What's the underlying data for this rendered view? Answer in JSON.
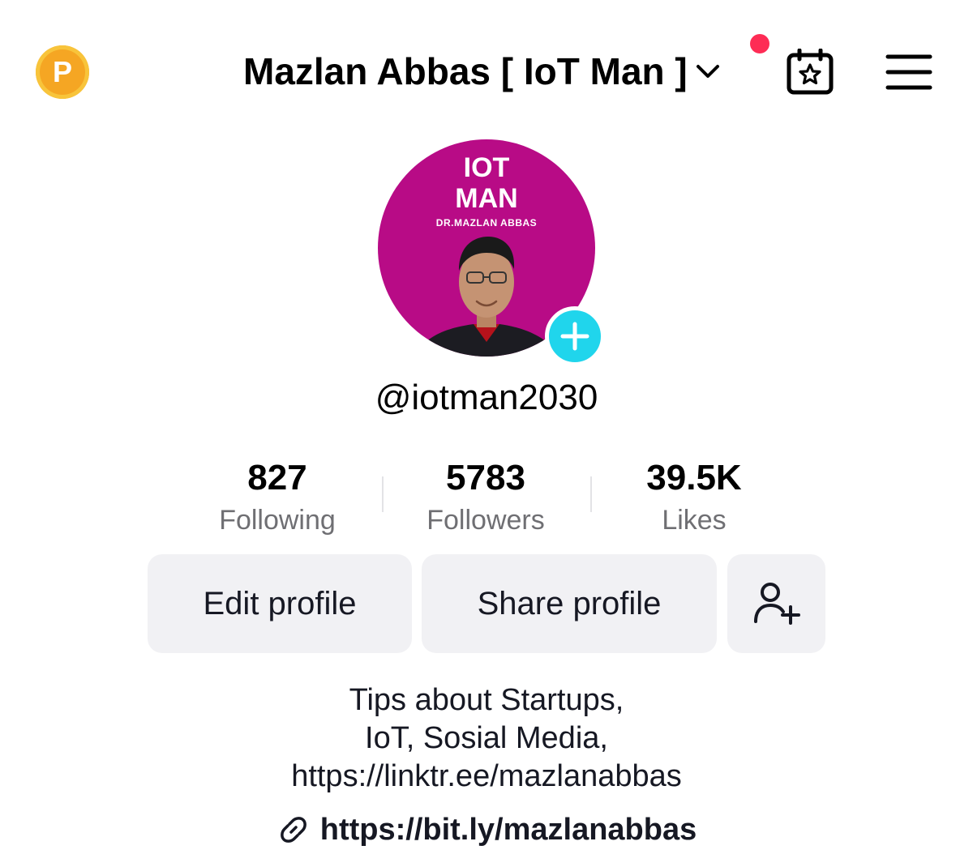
{
  "header": {
    "coin_letter": "P",
    "title": "Mazlan Abbas [ IoT Man ]",
    "notification_color": "#fe2c55"
  },
  "avatar": {
    "line1": "IOT",
    "line2": "MAN",
    "line3": "DR.MAZLAN ABBAS",
    "background_color": "#b80b86",
    "badge_color": "#20d5ec"
  },
  "profile": {
    "handle": "@iotman2030"
  },
  "stats": [
    {
      "value": "827",
      "label": "Following"
    },
    {
      "value": "5783",
      "label": "Followers"
    },
    {
      "value": "39.5K",
      "label": "Likes"
    }
  ],
  "buttons": {
    "edit": "Edit profile",
    "share": "Share profile"
  },
  "bio": {
    "lines": [
      "Tips about Startups,",
      "IoT, Sosial Media,",
      "https://linktr.ee/mazlanabbas"
    ],
    "link": "https://bit.ly/mazlanabbas"
  },
  "icons": {
    "coin": "coin-icon",
    "chevron": "chevron-down-icon",
    "calendar": "calendar-star-icon",
    "menu": "hamburger-menu-icon",
    "add_user": "add-friend-icon",
    "link": "link-icon",
    "plus": "plus-icon"
  }
}
